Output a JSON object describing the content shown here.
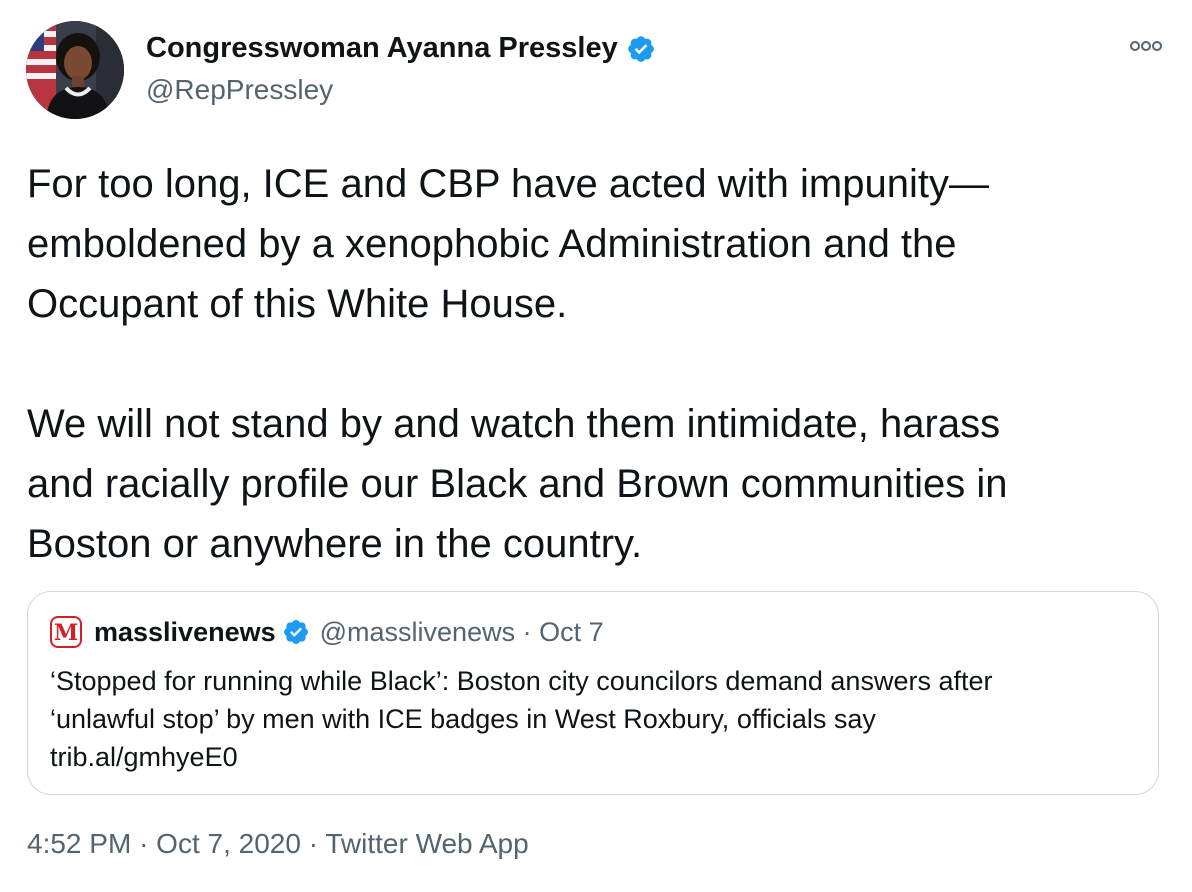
{
  "author": {
    "display_name": "Congresswoman Ayanna Pressley",
    "handle": "@RepPressley",
    "verified_icon": "verified-badge-icon",
    "avatar": "avatar-photo"
  },
  "tweet": {
    "paragraphs": [
      "For too long, ICE and CBP have acted with impunity—\nemboldened by a xenophobic Administration and the\nOccupant of this White House.",
      "We will not stand by and watch them intimidate, harass\nand racially profile our Black and Brown communities in\nBoston or anywhere in the country."
    ]
  },
  "quote": {
    "name": "masslivenews",
    "handle": "@masslivenews",
    "separator": "·",
    "date": "Oct 7",
    "logo_letter": "M",
    "body_line1": "‘Stopped for running while Black’: Boston city councilors demand answers after",
    "body_line2": "‘unlawful stop’ by men with ICE badges in West Roxbury, officials say",
    "link": "trib.al/gmhyeE0"
  },
  "footer": {
    "time": "4:52 PM",
    "date": "Oct 7, 2020",
    "separator": "·",
    "source": "Twitter Web App"
  },
  "colors": {
    "primary_text": "#0f1419",
    "secondary_text": "#536471",
    "verified_blue": "#1d9bf0",
    "border": "#cfd9de",
    "masslive_red": "#d32027"
  }
}
